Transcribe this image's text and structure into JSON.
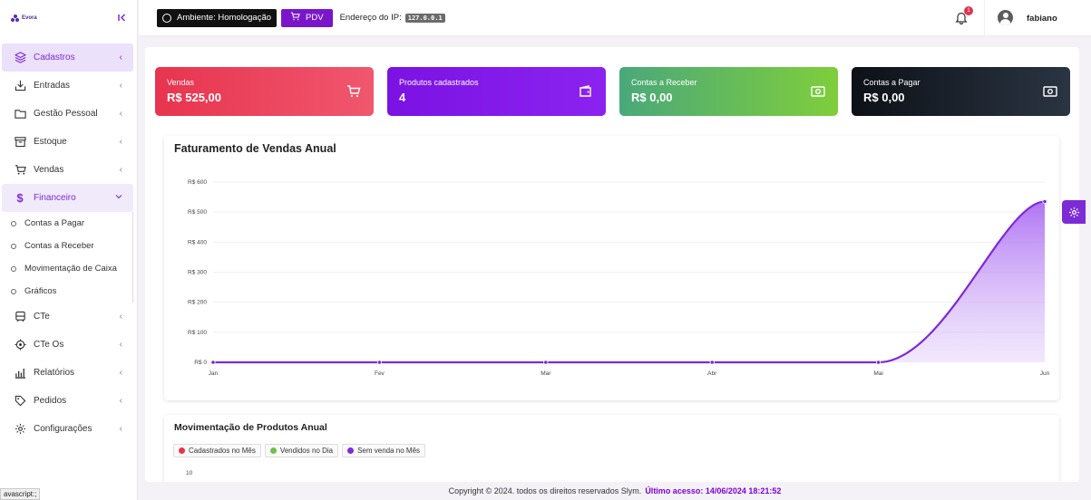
{
  "brand": {
    "name": "Evora"
  },
  "sidebar": {
    "items": [
      {
        "label": "Cadastros",
        "icon": "layers-icon"
      },
      {
        "label": "Entradas",
        "icon": "download-tray-icon"
      },
      {
        "label": "Gestão Pessoal",
        "icon": "folder-icon"
      },
      {
        "label": "Estoque",
        "icon": "archive-icon"
      },
      {
        "label": "Vendas",
        "icon": "cart-icon"
      },
      {
        "label": "Financeiro",
        "icon": "dollar-icon"
      },
      {
        "label": "CTe",
        "icon": "bus-icon"
      },
      {
        "label": "CTe Os",
        "icon": "target-icon"
      },
      {
        "label": "Relatórios",
        "icon": "bar-chart-icon"
      },
      {
        "label": "Pedidos",
        "icon": "tag-icon"
      },
      {
        "label": "Configurações",
        "icon": "gear-icon"
      }
    ],
    "financeiro_sub": [
      "Contas a Pagar",
      "Contas a Receber",
      "Movimentação de Caixa",
      "Gráficos"
    ]
  },
  "statusbar": {
    "text": "avascript:;"
  },
  "topbar": {
    "env_label": "Ambiente: Homologação",
    "pdv_label": "PDV",
    "ip_label": "Endereço do IP:",
    "ip_value": "127.0.0.1",
    "notifications": "1",
    "username": "fabiano"
  },
  "cards": [
    {
      "label": "Vendas",
      "value": "R$ 525,00",
      "icon": "cart-icon"
    },
    {
      "label": "Produtos cadastrados",
      "value": "4",
      "icon": "wallet-icon"
    },
    {
      "label": "Contas a Receber",
      "value": "R$ 0,00",
      "icon": "money-icon"
    },
    {
      "label": "Contas a Pagar",
      "value": "R$ 0,00",
      "icon": "money-icon"
    }
  ],
  "chart_data": [
    {
      "type": "area",
      "title": "Faturamento de Vendas Anual",
      "categories": [
        "Jan",
        "Fev",
        "Mar",
        "Abr",
        "Mai",
        "Jun"
      ],
      "values": [
        0,
        0,
        0,
        0,
        0,
        535
      ],
      "yticks": [
        "R$ 0",
        "R$ 100",
        "R$ 200",
        "R$ 300",
        "R$ 400",
        "R$ 500",
        "R$ 600"
      ],
      "ylim": [
        0,
        600
      ],
      "color": "#7c2bd6",
      "grid": true
    },
    {
      "type": "bar",
      "title": "Movimentação de Produtos Anual",
      "series": [
        {
          "name": "Cadastrados no Mês",
          "color": "#e8344f"
        },
        {
          "name": "Vendidos no Dia",
          "color": "#6cc24a"
        },
        {
          "name": "Sem venda no Mês",
          "color": "#7c2bd6"
        }
      ],
      "visible_ytick": "10"
    }
  ],
  "footer": {
    "copyright": "Copyright © 2024. todos os direitos reservados Slym.",
    "last_access": "Último acesso: 14/06/2024 18:21:52"
  }
}
